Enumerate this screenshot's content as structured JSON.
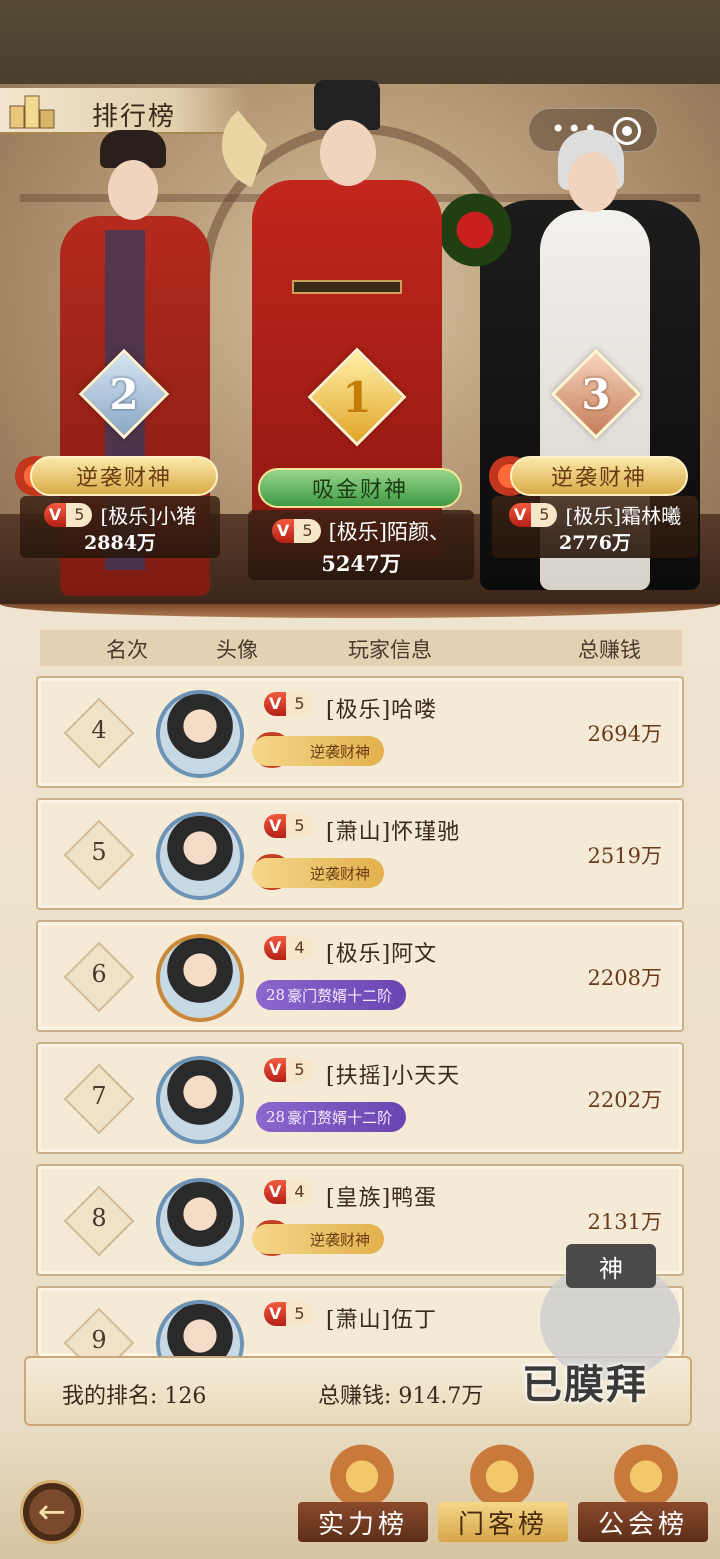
{
  "header": {
    "title": "排行榜"
  },
  "top3": [
    {
      "rank": "2",
      "title": "逆袭财神",
      "vip": "5",
      "name": "[极乐]小猪",
      "money": "2884万"
    },
    {
      "rank": "1",
      "title": "吸金财神",
      "vip": "5",
      "name": "[极乐]陌颜、",
      "money": "5247万"
    },
    {
      "rank": "3",
      "title": "逆袭财神",
      "vip": "5",
      "name": "[极乐]霜林曦",
      "money": "2776万"
    }
  ],
  "table": {
    "headers": {
      "rank": "名次",
      "avatar": "头像",
      "info": "玩家信息",
      "money": "总赚钱"
    },
    "rows": [
      {
        "rank": "4",
        "vip": "5",
        "name": "[极乐]哈喽",
        "title": "逆袭财神",
        "money": "2694万"
      },
      {
        "rank": "5",
        "vip": "5",
        "name": "[萧山]怀瑾驰",
        "title": "逆袭财神",
        "money": "2519万"
      },
      {
        "rank": "6",
        "vip": "4",
        "name": "[极乐]阿文",
        "title_level": "28",
        "title": "豪门赘婿十二阶",
        "money": "2208万"
      },
      {
        "rank": "7",
        "vip": "5",
        "name": "[扶摇]小天天",
        "title_level": "28",
        "title": "豪门赘婿十二阶",
        "money": "2202万"
      },
      {
        "rank": "8",
        "vip": "4",
        "name": "[皇族]鸭蛋",
        "title": "逆袭财神",
        "money": "2131万"
      },
      {
        "rank": "9",
        "vip": "5",
        "name": "[萧山]伍丁"
      }
    ]
  },
  "my": {
    "rank_label": "我的排名: 126",
    "money_label": "总赚钱: 914.7万",
    "worship_stamp": "已膜拜",
    "worship_badge": "神"
  },
  "tabs": {
    "strength": "实力榜",
    "guest": "门客榜",
    "guild": "公会榜"
  },
  "icons": {
    "back": "back-arrow-icon",
    "more": "more-dots-icon",
    "close": "target-close-icon"
  },
  "colors": {
    "accent_gold": "#d9ab48",
    "vip_red": "#b42016",
    "title_purple": "#6a44b2",
    "rank_text": "#6a3a1c"
  }
}
